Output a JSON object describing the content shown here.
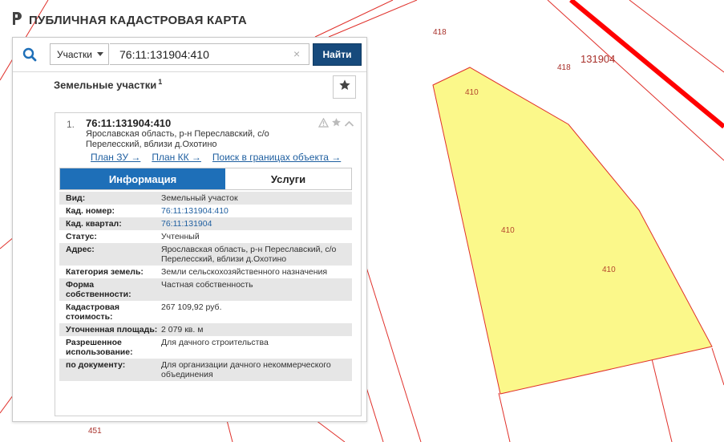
{
  "app": {
    "title": "ПУБЛИЧНАЯ КАДАСТРОВАЯ КАРТА"
  },
  "search": {
    "type_label": "Участки",
    "query": "76:11:131904:410",
    "clear_label": "×",
    "submit_label": "Найти"
  },
  "results": {
    "header": "Земельные участки",
    "count": "1"
  },
  "card": {
    "index": "1.",
    "number": "76:11:131904:410",
    "address": "Ярославская область, р-н Переславский, с/о Перелесский, вблизи д.Охотино",
    "links": {
      "plan_zu": "План ЗУ →",
      "plan_kk": "План КК →",
      "search_in_bounds": "Поиск в границах объекта →"
    },
    "tabs": {
      "info": "Информация",
      "services": "Услуги"
    },
    "attributes": [
      {
        "label": "Вид:",
        "value": "Земельный участок"
      },
      {
        "label": "Кад. номер:",
        "value": "76:11:131904:410"
      },
      {
        "label": "Кад. квартал:",
        "value": "76:11:131904"
      },
      {
        "label": "Статус:",
        "value": "Учтенный"
      },
      {
        "label": "Адрес:",
        "value": "Ярославская область, р-н Переславский, с/о Перелесский, вблизи д.Охотино"
      },
      {
        "label": "Категория земель:",
        "value": "Земли сельскохозяйственного назначения"
      },
      {
        "label": "Форма собственности:",
        "value": "Частная собственность"
      },
      {
        "label": "Кадастровая стоимость:",
        "value": "267 109,92 руб."
      },
      {
        "label": "Уточненная площадь:",
        "value": "2 079 кв. м"
      },
      {
        "label": "Разрешенное использование:",
        "value": "Для дачного строительства"
      },
      {
        "label": "по документу:",
        "value": "Для организации дачного некоммерческого объединения"
      }
    ]
  },
  "map": {
    "labels": {
      "parcel_418_top": "418",
      "parcel_418_right": "418",
      "quarter": "131904",
      "parcel_410_a": "410",
      "parcel_410_b": "410",
      "parcel_410_c": "410",
      "parcel_451": "451"
    },
    "colors": {
      "boundary": "#e0302a",
      "quarter_boundary": "#ff0000",
      "parcel_fill": "#fbf88a",
      "accent": "#1e6fb8",
      "find_button": "#174a7c"
    }
  }
}
